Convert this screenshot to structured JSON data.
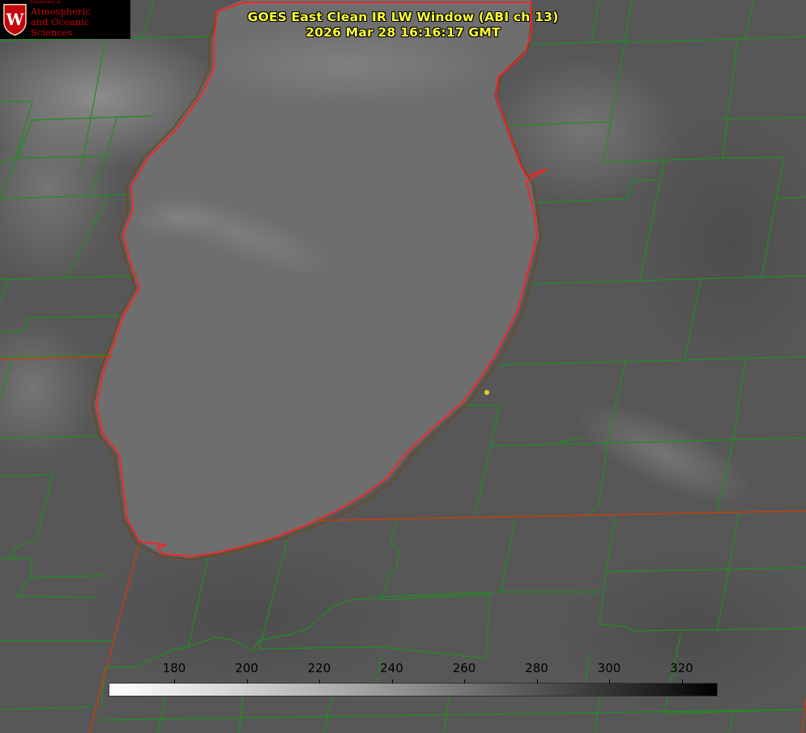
{
  "header": {
    "title_line1": "GOES East Clean IR LW Window (ABI ch 13)",
    "title_line2": "2026 Mar 28 16:16:17 GMT",
    "title_color": "#ffff33"
  },
  "logo": {
    "department": "Department of",
    "line1": "Atmospheric",
    "line2": "and Oceanic Sciences",
    "seal_letter": "W",
    "brand_color": "#c5050c"
  },
  "map": {
    "subject": "Lake Michigan satellite infrared view",
    "coastline_color": "#ff2020",
    "county_border_color": "#1f8f1f",
    "state_border_color": "#c04010",
    "marker_color": "#e6d21e"
  },
  "colorbar": {
    "label_values": [
      "180",
      "200",
      "220",
      "240",
      "260",
      "280",
      "300",
      "320"
    ],
    "gradient": "white-to-black"
  }
}
